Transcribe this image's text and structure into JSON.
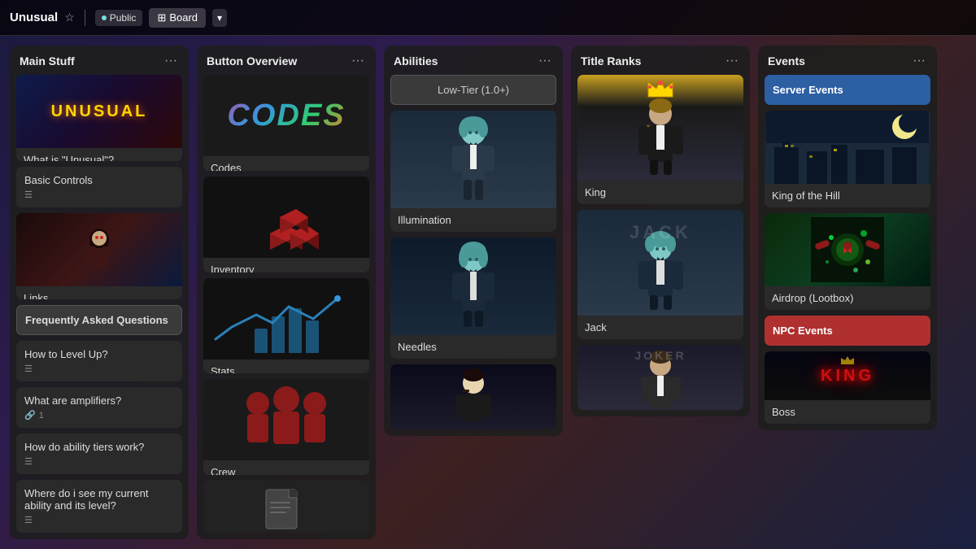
{
  "nav": {
    "title": "Unusual",
    "visibility": "Public",
    "view": "Board",
    "star_label": "★",
    "chevron": "▾"
  },
  "columns": [
    {
      "id": "main-stuff",
      "title": "Main Stuff",
      "cards": [
        {
          "id": "what-is-unusual",
          "type": "image-text",
          "title": "What is \"Unusual\"?",
          "image_type": "unusual-logo"
        },
        {
          "id": "basic-controls",
          "type": "text-meta",
          "title": "Basic Controls",
          "meta_type": "lines"
        },
        {
          "id": "links",
          "type": "image-text",
          "title": "Links",
          "image_type": "anime"
        },
        {
          "id": "faq",
          "type": "highlighted-text",
          "title": "Frequently Asked Questions"
        },
        {
          "id": "how-to-level",
          "type": "text-meta",
          "title": "How to Level Up?",
          "meta_type": "lines"
        },
        {
          "id": "amplifiers",
          "type": "text-meta-count",
          "title": "What are amplifiers?",
          "meta_type": "link",
          "count": "1"
        },
        {
          "id": "ability-tiers",
          "type": "text-meta",
          "title": "How do ability tiers work?",
          "meta_type": "lines"
        },
        {
          "id": "current-ability",
          "type": "text-meta",
          "title": "Where do i see my current ability and its level?",
          "meta_type": "lines"
        }
      ]
    },
    {
      "id": "button-overview",
      "title": "Button Overview",
      "cards": [
        {
          "id": "codes",
          "type": "image-text",
          "title": "Codes",
          "image_type": "codes"
        },
        {
          "id": "inventory",
          "type": "image-text",
          "title": "Inventory",
          "image_type": "inventory"
        },
        {
          "id": "stats",
          "type": "image-text",
          "title": "Stats",
          "image_type": "stats"
        },
        {
          "id": "crew",
          "type": "image-text",
          "title": "Crew",
          "image_type": "crew"
        },
        {
          "id": "bottom-card",
          "type": "image-only",
          "image_type": "document"
        }
      ]
    },
    {
      "id": "abilities",
      "title": "Abilities",
      "cards": [
        {
          "id": "low-tier",
          "type": "low-tier",
          "title": "Low-Tier (1.0+)"
        },
        {
          "id": "illumination",
          "type": "image-text",
          "title": "Illumination",
          "image_type": "char-teal"
        },
        {
          "id": "needles",
          "type": "image-text",
          "title": "Needles",
          "image_type": "char-teal2"
        },
        {
          "id": "joker-ability",
          "type": "image-only",
          "image_type": "char-dark"
        }
      ]
    },
    {
      "id": "title-ranks",
      "title": "Title Ranks",
      "cards": [
        {
          "id": "king",
          "type": "image-text",
          "title": "King",
          "image_type": "king-char"
        },
        {
          "id": "jack",
          "type": "image-text",
          "title": "Jack",
          "image_type": "jack-char"
        },
        {
          "id": "joker",
          "type": "image-only",
          "image_type": "joker-char"
        }
      ]
    },
    {
      "id": "events",
      "title": "Events",
      "cards": [
        {
          "id": "server-events",
          "type": "blue-highlight",
          "title": "Server Events"
        },
        {
          "id": "king-of-hill",
          "type": "image-text",
          "title": "King of the Hill",
          "image_type": "koth"
        },
        {
          "id": "airdrop",
          "type": "image-text",
          "title": "Airdrop (Lootbox)",
          "image_type": "airdrop"
        },
        {
          "id": "npc-events",
          "type": "red-highlight",
          "title": "NPC Events"
        },
        {
          "id": "boss",
          "type": "image-text",
          "title": "Boss",
          "image_type": "boss"
        }
      ]
    }
  ]
}
